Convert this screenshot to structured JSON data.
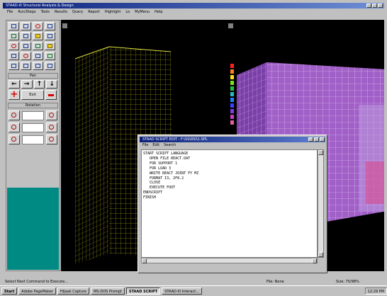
{
  "window": {
    "title": "STAAD-III Structural Analysis & Design"
  },
  "menu": [
    "File",
    "Run/Steps",
    "Tools",
    "Results",
    "Query",
    "Report",
    "Highlight",
    "Lo",
    "MyMenu",
    "Help"
  ],
  "toolbox": {
    "pan_label": "Pan",
    "zoom_label": "Exit",
    "rotation_label": "Rotation",
    "rotation_values": [
      "",
      "",
      ""
    ]
  },
  "editor": {
    "title": "STAAD SCRIPT EDIT - F:\\SS\\RSI\\1.SPL",
    "menu": [
      "File",
      "Edit",
      "Search"
    ],
    "lines": [
      "START SCRIPT LANGUAGE",
      "   OPEN FILE REACT.DAT",
      "   FOR SUPPORT 1",
      "   FOR LOAD 3",
      "   WRITE REACT JOINT FY MZ",
      "   FORMAT I3, 2F8.2",
      "   CLOSE",
      "   EXECUTE FOOT",
      "ENDSCRIPT",
      "FINISH"
    ]
  },
  "status": {
    "hint": "Select Next Command to Execute...",
    "file_label": "File: None",
    "size_label": "Size: 75/98%"
  },
  "taskbar": {
    "start": "Start",
    "items": [
      "Adobe PageMaker",
      "HiJaak Capture",
      "MS-DOS Prompt",
      "STAAD SCRIPT",
      "STAAD-III Interact..."
    ],
    "active_index": 3,
    "clock": "12:29 PM"
  },
  "colors": {
    "title_gradient_start": "#0a1f7a",
    "desktop_teal": "#008a84",
    "wire_yellow": "#d8d820",
    "contour_purple": "#b070d0"
  }
}
